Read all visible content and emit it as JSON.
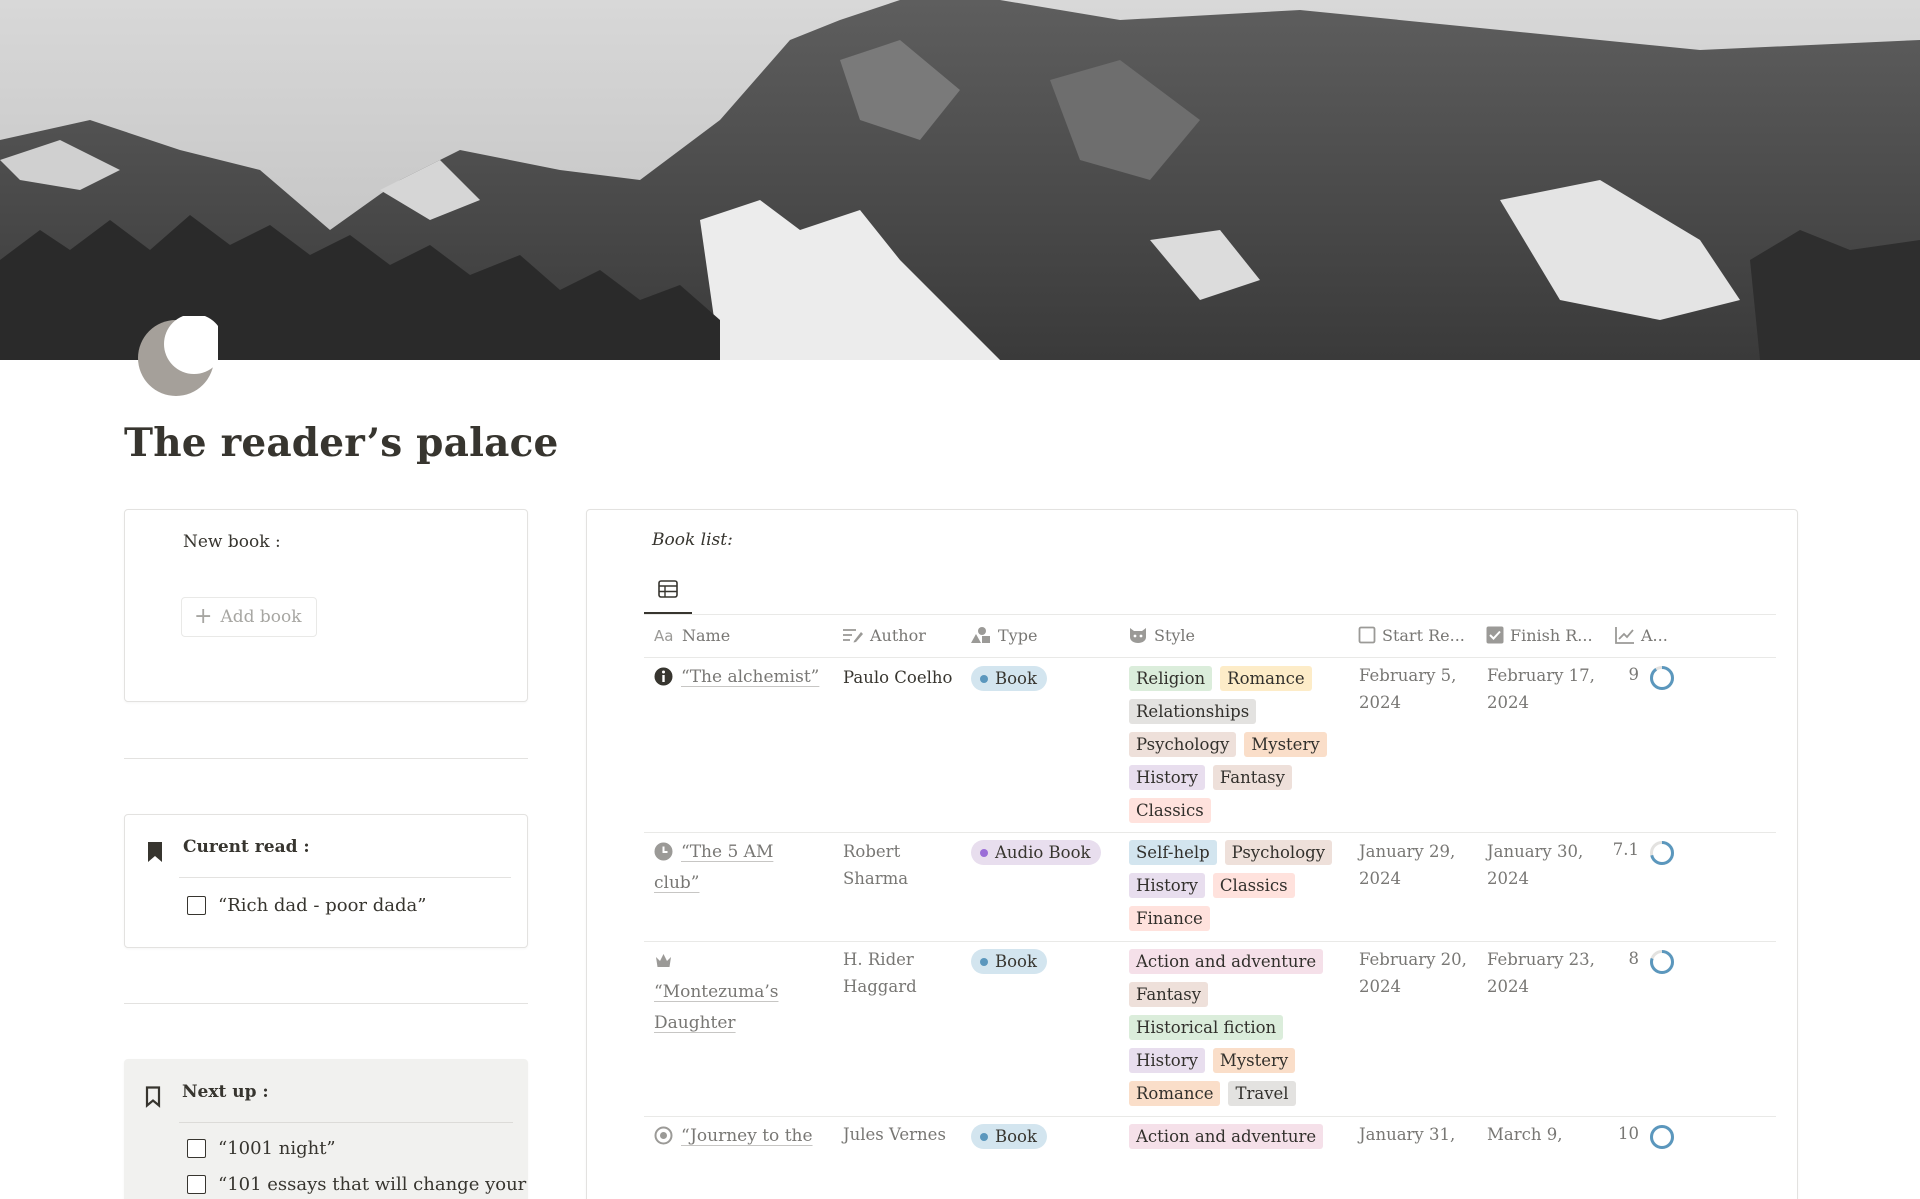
{
  "page": {
    "title": "The reader’s palace",
    "icon": "crescent-moon-icon"
  },
  "new_book": {
    "label": "New book :",
    "add_button": "Add book"
  },
  "current_read": {
    "label": "Curent read :",
    "items": [
      "“Rich dad - poor dada”"
    ]
  },
  "next_up": {
    "label": "Next up :",
    "items": [
      "“1001 night”",
      "“101 essays that will change your"
    ]
  },
  "book_list": {
    "title": "Book list:",
    "view_icon": "table-icon",
    "columns": [
      {
        "label": "Name",
        "icon": "text-aa-icon"
      },
      {
        "label": "Author",
        "icon": "text-lines-icon"
      },
      {
        "label": "Type",
        "icon": "shapes-icon"
      },
      {
        "label": "Style",
        "icon": "cat-face-icon"
      },
      {
        "label": "Start Re...",
        "icon": "checkbox-empty-icon"
      },
      {
        "label": "Finish R...",
        "icon": "checkbox-checked-icon"
      },
      {
        "label": "A...",
        "icon": "trend-chart-icon"
      }
    ],
    "rows": [
      {
        "name": "“The alchemist”",
        "name_icon": "info-icon",
        "author": "Paulo Coelho",
        "type": "Book",
        "type_color": "#d3e5ef",
        "type_dot": "#5b97bd",
        "styles": [
          {
            "label": "Religion",
            "color": "#dbeddb"
          },
          {
            "label": "Romance",
            "color": "#fdecc8"
          },
          {
            "label": "Relationships",
            "color": "#e3e2e0"
          },
          {
            "label": "Psychology",
            "color": "#eee0da"
          },
          {
            "label": "Mystery",
            "color": "#fadec9"
          },
          {
            "label": "History",
            "color": "#e8deee"
          },
          {
            "label": "Fantasy",
            "color": "#eee0da"
          },
          {
            "label": "Classics",
            "color": "#ffe2dd"
          }
        ],
        "start": "February 5, 2024",
        "finish": "February 17, 2024",
        "rating": "9",
        "rating_fraction": 0.9
      },
      {
        "name": "“The 5 AM club”",
        "name_icon": "clock-icon",
        "author": "Robert Sharma",
        "type": "Audio Book",
        "type_color": "#e8deee",
        "type_dot": "#9a6dd7",
        "styles": [
          {
            "label": "Self-help",
            "color": "#d3e5ef"
          },
          {
            "label": "Psychology",
            "color": "#eee0da"
          },
          {
            "label": "History",
            "color": "#e8deee"
          },
          {
            "label": "Classics",
            "color": "#ffe2dd"
          },
          {
            "label": "Finance",
            "color": "#ffe2dd"
          }
        ],
        "start": "January 29, 2024",
        "finish": "January 30, 2024",
        "rating": "7.1",
        "rating_fraction": 0.71
      },
      {
        "name": "“Montezuma’s Daughter",
        "name_icon": "crown-icon",
        "author": "H. Rider Haggard",
        "type": "Book",
        "type_color": "#d3e5ef",
        "type_dot": "#5b97bd",
        "styles": [
          {
            "label": "Action and adventure",
            "color": "#f5e0e9"
          },
          {
            "label": "Fantasy",
            "color": "#eee0da"
          },
          {
            "label": "Historical fiction",
            "color": "#dbeddb"
          },
          {
            "label": "History",
            "color": "#e8deee"
          },
          {
            "label": "Mystery",
            "color": "#fadec9"
          },
          {
            "label": "Romance",
            "color": "#fadec9"
          },
          {
            "label": "Travel",
            "color": "#e3e2e0"
          }
        ],
        "start": "February 20, 2024",
        "finish": "February 23, 2024",
        "rating": "8",
        "rating_fraction": 0.8
      },
      {
        "name": "“Journey to the",
        "name_icon": "target-icon",
        "author": "Jules Vernes",
        "type": "Book",
        "type_color": "#d3e5ef",
        "type_dot": "#5b97bd",
        "styles": [
          {
            "label": "Action and adventure",
            "color": "#f5e0e9"
          }
        ],
        "start": "January 31,",
        "finish": "March 9,",
        "rating": "10",
        "rating_fraction": 1.0
      }
    ]
  }
}
